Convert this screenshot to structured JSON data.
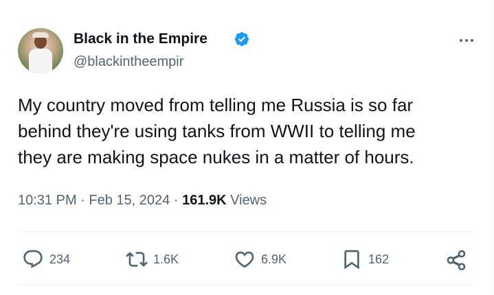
{
  "author": {
    "display_name": "Black in the Empire",
    "handle": "@blackintheempir",
    "verified": true
  },
  "tweet": {
    "text": "My country moved from telling me Russia is so far\nbehind they're using tanks from WWII to telling me\nthey are making space nukes in a matter of hours.",
    "time": "10:31 PM",
    "separator": "·",
    "date": "Feb 15, 2024",
    "views_count": "161.9K",
    "views_label": "Views"
  },
  "actions": {
    "replies": "234",
    "reposts": "1.6K",
    "likes": "6.9K",
    "bookmarks": "162"
  },
  "icons": {
    "verified": "verified-badge-icon",
    "more": "more-icon",
    "reply": "reply-icon",
    "repost": "repost-icon",
    "like": "like-icon",
    "bookmark": "bookmark-icon",
    "share": "share-icon"
  },
  "colors": {
    "verified_blue": "#1d9bf0",
    "text_primary": "#0f1419",
    "text_secondary": "#536471",
    "divider": "#eff3f4"
  }
}
